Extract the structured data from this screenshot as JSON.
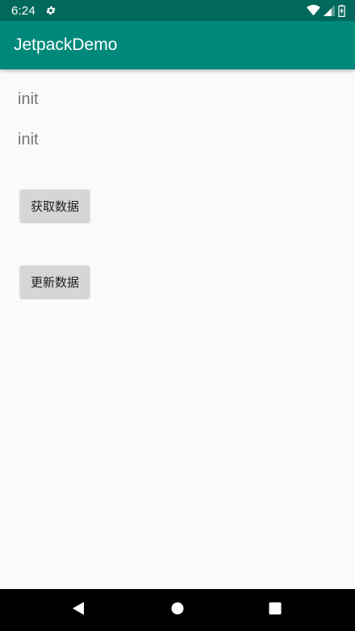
{
  "status_bar": {
    "time": "6:24",
    "icons": [
      "gear-icon",
      "wifi-icon",
      "cell-signal-icon",
      "battery-icon"
    ]
  },
  "app_bar": {
    "title": "JetpackDemo"
  },
  "content": {
    "text_1": "init",
    "text_2": "init",
    "fetch_button_label": "获取数据",
    "update_button_label": "更新数据"
  },
  "nav_bar": {
    "icons": [
      "back-icon",
      "home-icon",
      "recents-icon"
    ]
  },
  "colors": {
    "status_bar": "#00695c",
    "app_bar": "#00897b",
    "background": "#fafafa",
    "button": "#d6d6d6",
    "text_secondary": "#757575",
    "nav_bar": "#000000"
  }
}
